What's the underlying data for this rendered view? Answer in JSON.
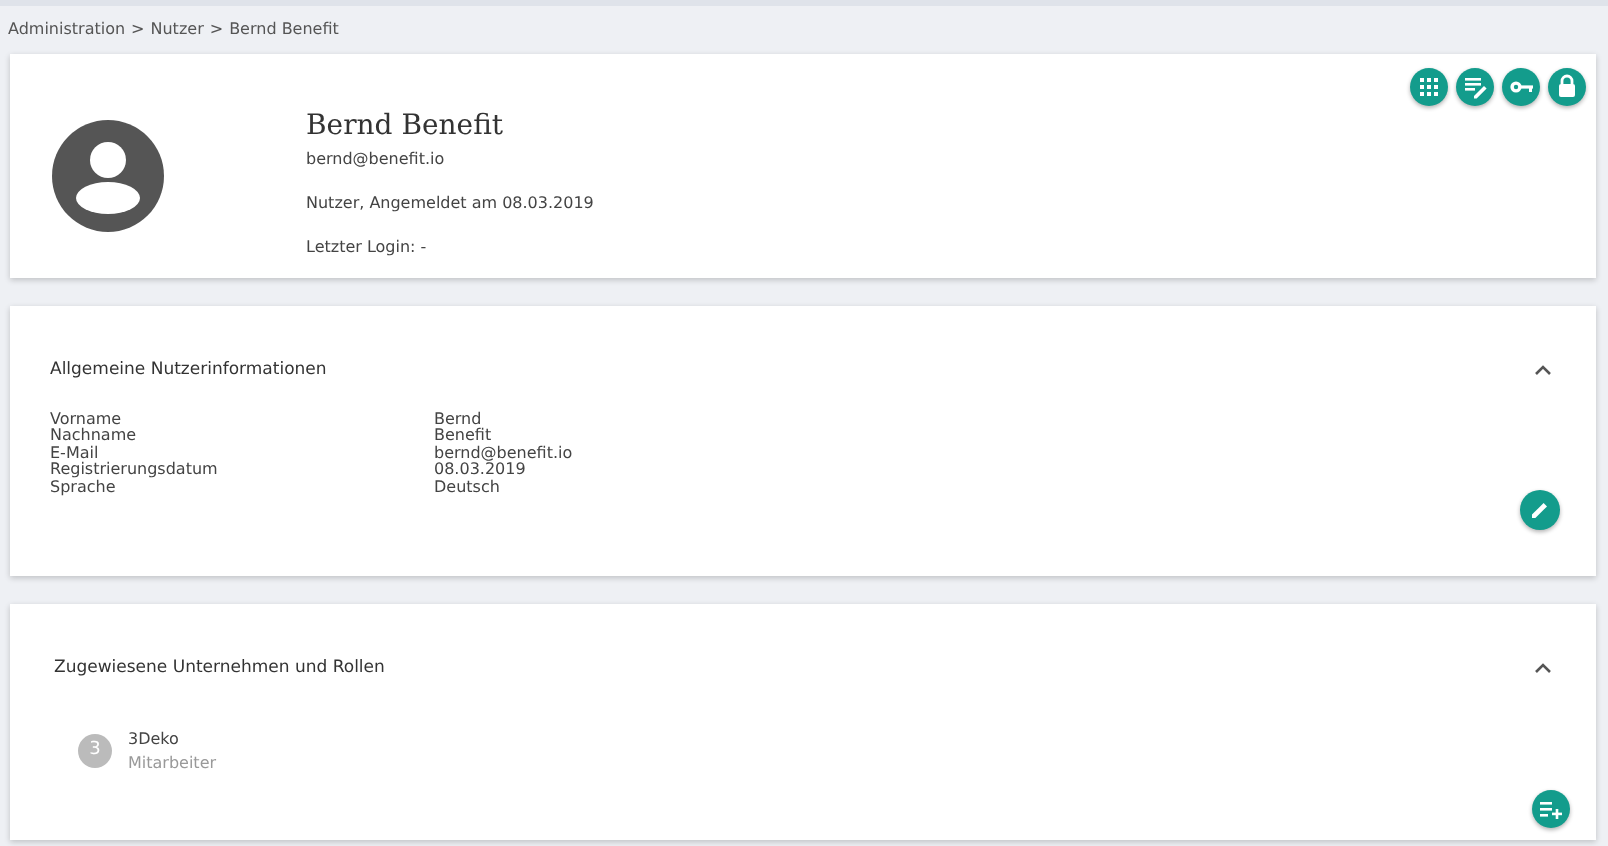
{
  "breadcrumb": {
    "items": [
      "Administration",
      "Nutzer",
      "Bernd Benefit"
    ],
    "separator": ">"
  },
  "profile": {
    "name": "Bernd Benefit",
    "email": "bernd@benefit.io",
    "status": "Nutzer, Angemeldet am 08.03.2019",
    "last_login": "Letzter Login: -"
  },
  "actions": [
    {
      "kind": "grid"
    },
    {
      "kind": "edit-note"
    },
    {
      "kind": "key"
    },
    {
      "kind": "lock"
    }
  ],
  "info_panel": {
    "title": "Allgemeine Nutzerinformationen",
    "expanded": true,
    "fields": [
      {
        "label": "Vorname",
        "value": "Bernd"
      },
      {
        "label": "Nachname",
        "value": "Benefit"
      },
      {
        "label": "E-Mail",
        "value": "bernd@benefit.io"
      },
      {
        "label": "Registrierungsdatum",
        "value": "08.03.2019"
      },
      {
        "label": "Sprache",
        "value": "Deutsch"
      }
    ]
  },
  "companies_panel": {
    "title": "Zugewiesene Unternehmen und Rollen",
    "expanded": true,
    "items": [
      {
        "initial": "3",
        "name": "3Deko",
        "role": "Mitarbeiter"
      }
    ]
  }
}
